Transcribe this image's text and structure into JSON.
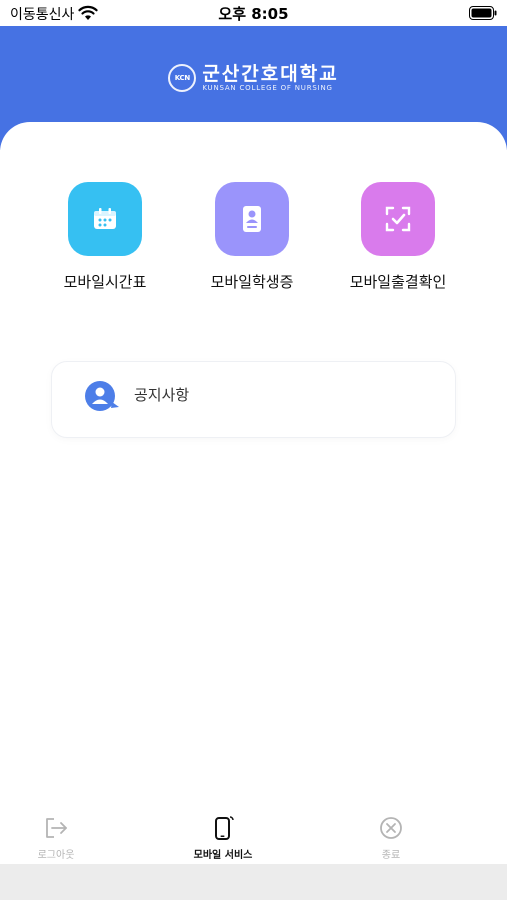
{
  "status": {
    "carrier": "이동통신사",
    "time": "오후 8:05"
  },
  "header": {
    "logo_seal": "KCN",
    "logo_korean": "군산간호대학교",
    "logo_english": "KUNSAN COLLEGE OF NURSING",
    "bg_color": "#4672e3"
  },
  "menu": [
    {
      "label": "모바일시간표",
      "icon": "calendar-icon",
      "color": "#36c0f2"
    },
    {
      "label": "모바일학생증",
      "icon": "id-card-icon",
      "color": "#9a94fb"
    },
    {
      "label": "모바일출결확인",
      "icon": "scan-check-icon",
      "color": "#d97bec"
    }
  ],
  "notice": {
    "label": "공지사항",
    "icon": "user-speech-icon"
  },
  "tabs": [
    {
      "label": "로그아웃",
      "icon": "logout-icon",
      "active": false
    },
    {
      "label": "모바일 서비스",
      "icon": "mobile-device-icon",
      "active": true
    },
    {
      "label": "종료",
      "icon": "close-circle-icon",
      "active": false
    }
  ]
}
